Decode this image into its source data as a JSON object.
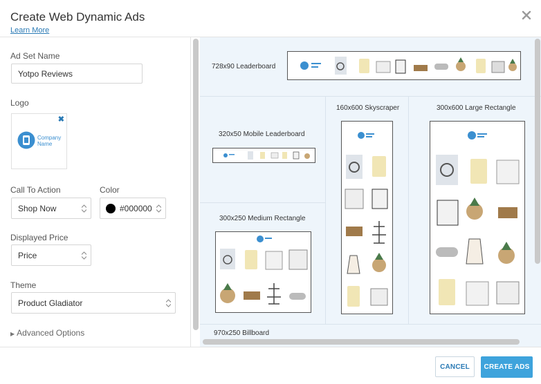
{
  "header": {
    "title": "Create Web Dynamic Ads",
    "learn_more": "Learn More"
  },
  "form": {
    "ad_set_name_label": "Ad Set Name",
    "ad_set_name_value": "Yotpo Reviews",
    "logo_label": "Logo",
    "logo_text_line1": "Company",
    "logo_text_line2": "Name",
    "cta_label": "Call To Action",
    "cta_value": "Shop Now",
    "color_label": "Color",
    "color_value": "#000000",
    "color_swatch": "#000000",
    "price_label": "Displayed Price",
    "price_value": "Price",
    "theme_label": "Theme",
    "theme_value": "Product Gladiator",
    "advanced_options": "Advanced Options"
  },
  "preview": {
    "leaderboard": "728x90 Leaderboard",
    "mobile_leaderboard": "320x50 Mobile Leaderboard",
    "skyscraper": "160x600 Skyscraper",
    "large_rectangle": "300x600 Large Rectangle",
    "medium_rectangle": "300x250 Medium Rectangle",
    "billboard": "970x250 Billboard"
  },
  "footer": {
    "cancel": "CANCEL",
    "create": "CREATE ADS"
  },
  "colors": {
    "accent": "#3ea3dc",
    "link": "#2a7ab5",
    "preview_bg": "#eef5fb"
  }
}
